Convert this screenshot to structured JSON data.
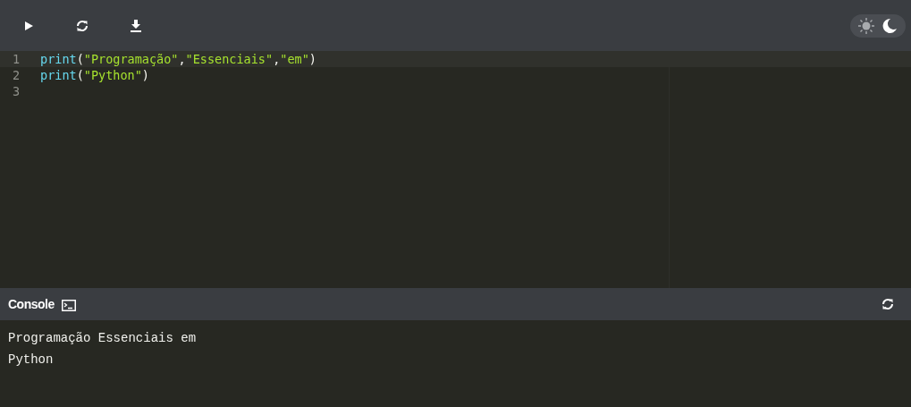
{
  "toolbar": {
    "buttons": [
      {
        "kind": "run"
      },
      {
        "kind": "reset"
      },
      {
        "kind": "download"
      }
    ],
    "dark_mode": true
  },
  "editor": {
    "lines": [
      {
        "number": "1",
        "active": true,
        "tokens": [
          {
            "kind": "func",
            "text": "print"
          },
          {
            "kind": "punct",
            "text": "("
          },
          {
            "kind": "string",
            "text": "\"Programação\""
          },
          {
            "kind": "punct",
            "text": ","
          },
          {
            "kind": "string",
            "text": "\"Essenciais\""
          },
          {
            "kind": "punct",
            "text": ","
          },
          {
            "kind": "string",
            "text": "\"em\""
          },
          {
            "kind": "punct",
            "text": ")"
          }
        ]
      },
      {
        "number": "2",
        "active": false,
        "tokens": [
          {
            "kind": "func",
            "text": "print"
          },
          {
            "kind": "punct",
            "text": "("
          },
          {
            "kind": "string",
            "text": "\"Python\""
          },
          {
            "kind": "punct",
            "text": ")"
          }
        ]
      },
      {
        "number": "3",
        "active": false
      }
    ]
  },
  "console": {
    "title": "Console",
    "output": [
      "Programação Essenciais em",
      "Python"
    ]
  }
}
